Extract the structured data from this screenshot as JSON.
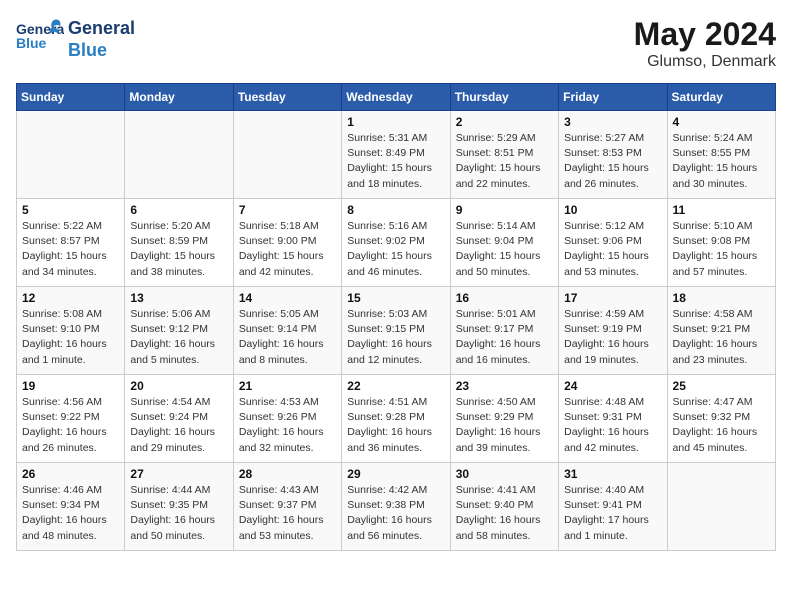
{
  "logo": {
    "general": "General",
    "blue": "Blue"
  },
  "title": {
    "month_year": "May 2024",
    "location": "Glumso, Denmark"
  },
  "weekdays": [
    "Sunday",
    "Monday",
    "Tuesday",
    "Wednesday",
    "Thursday",
    "Friday",
    "Saturday"
  ],
  "weeks": [
    [
      {
        "day": "",
        "info": ""
      },
      {
        "day": "",
        "info": ""
      },
      {
        "day": "",
        "info": ""
      },
      {
        "day": "1",
        "info": "Sunrise: 5:31 AM\nSunset: 8:49 PM\nDaylight: 15 hours\nand 18 minutes."
      },
      {
        "day": "2",
        "info": "Sunrise: 5:29 AM\nSunset: 8:51 PM\nDaylight: 15 hours\nand 22 minutes."
      },
      {
        "day": "3",
        "info": "Sunrise: 5:27 AM\nSunset: 8:53 PM\nDaylight: 15 hours\nand 26 minutes."
      },
      {
        "day": "4",
        "info": "Sunrise: 5:24 AM\nSunset: 8:55 PM\nDaylight: 15 hours\nand 30 minutes."
      }
    ],
    [
      {
        "day": "5",
        "info": "Sunrise: 5:22 AM\nSunset: 8:57 PM\nDaylight: 15 hours\nand 34 minutes."
      },
      {
        "day": "6",
        "info": "Sunrise: 5:20 AM\nSunset: 8:59 PM\nDaylight: 15 hours\nand 38 minutes."
      },
      {
        "day": "7",
        "info": "Sunrise: 5:18 AM\nSunset: 9:00 PM\nDaylight: 15 hours\nand 42 minutes."
      },
      {
        "day": "8",
        "info": "Sunrise: 5:16 AM\nSunset: 9:02 PM\nDaylight: 15 hours\nand 46 minutes."
      },
      {
        "day": "9",
        "info": "Sunrise: 5:14 AM\nSunset: 9:04 PM\nDaylight: 15 hours\nand 50 minutes."
      },
      {
        "day": "10",
        "info": "Sunrise: 5:12 AM\nSunset: 9:06 PM\nDaylight: 15 hours\nand 53 minutes."
      },
      {
        "day": "11",
        "info": "Sunrise: 5:10 AM\nSunset: 9:08 PM\nDaylight: 15 hours\nand 57 minutes."
      }
    ],
    [
      {
        "day": "12",
        "info": "Sunrise: 5:08 AM\nSunset: 9:10 PM\nDaylight: 16 hours\nand 1 minute."
      },
      {
        "day": "13",
        "info": "Sunrise: 5:06 AM\nSunset: 9:12 PM\nDaylight: 16 hours\nand 5 minutes."
      },
      {
        "day": "14",
        "info": "Sunrise: 5:05 AM\nSunset: 9:14 PM\nDaylight: 16 hours\nand 8 minutes."
      },
      {
        "day": "15",
        "info": "Sunrise: 5:03 AM\nSunset: 9:15 PM\nDaylight: 16 hours\nand 12 minutes."
      },
      {
        "day": "16",
        "info": "Sunrise: 5:01 AM\nSunset: 9:17 PM\nDaylight: 16 hours\nand 16 minutes."
      },
      {
        "day": "17",
        "info": "Sunrise: 4:59 AM\nSunset: 9:19 PM\nDaylight: 16 hours\nand 19 minutes."
      },
      {
        "day": "18",
        "info": "Sunrise: 4:58 AM\nSunset: 9:21 PM\nDaylight: 16 hours\nand 23 minutes."
      }
    ],
    [
      {
        "day": "19",
        "info": "Sunrise: 4:56 AM\nSunset: 9:22 PM\nDaylight: 16 hours\nand 26 minutes."
      },
      {
        "day": "20",
        "info": "Sunrise: 4:54 AM\nSunset: 9:24 PM\nDaylight: 16 hours\nand 29 minutes."
      },
      {
        "day": "21",
        "info": "Sunrise: 4:53 AM\nSunset: 9:26 PM\nDaylight: 16 hours\nand 32 minutes."
      },
      {
        "day": "22",
        "info": "Sunrise: 4:51 AM\nSunset: 9:28 PM\nDaylight: 16 hours\nand 36 minutes."
      },
      {
        "day": "23",
        "info": "Sunrise: 4:50 AM\nSunset: 9:29 PM\nDaylight: 16 hours\nand 39 minutes."
      },
      {
        "day": "24",
        "info": "Sunrise: 4:48 AM\nSunset: 9:31 PM\nDaylight: 16 hours\nand 42 minutes."
      },
      {
        "day": "25",
        "info": "Sunrise: 4:47 AM\nSunset: 9:32 PM\nDaylight: 16 hours\nand 45 minutes."
      }
    ],
    [
      {
        "day": "26",
        "info": "Sunrise: 4:46 AM\nSunset: 9:34 PM\nDaylight: 16 hours\nand 48 minutes."
      },
      {
        "day": "27",
        "info": "Sunrise: 4:44 AM\nSunset: 9:35 PM\nDaylight: 16 hours\nand 50 minutes."
      },
      {
        "day": "28",
        "info": "Sunrise: 4:43 AM\nSunset: 9:37 PM\nDaylight: 16 hours\nand 53 minutes."
      },
      {
        "day": "29",
        "info": "Sunrise: 4:42 AM\nSunset: 9:38 PM\nDaylight: 16 hours\nand 56 minutes."
      },
      {
        "day": "30",
        "info": "Sunrise: 4:41 AM\nSunset: 9:40 PM\nDaylight: 16 hours\nand 58 minutes."
      },
      {
        "day": "31",
        "info": "Sunrise: 4:40 AM\nSunset: 9:41 PM\nDaylight: 17 hours\nand 1 minute."
      },
      {
        "day": "",
        "info": ""
      }
    ]
  ]
}
